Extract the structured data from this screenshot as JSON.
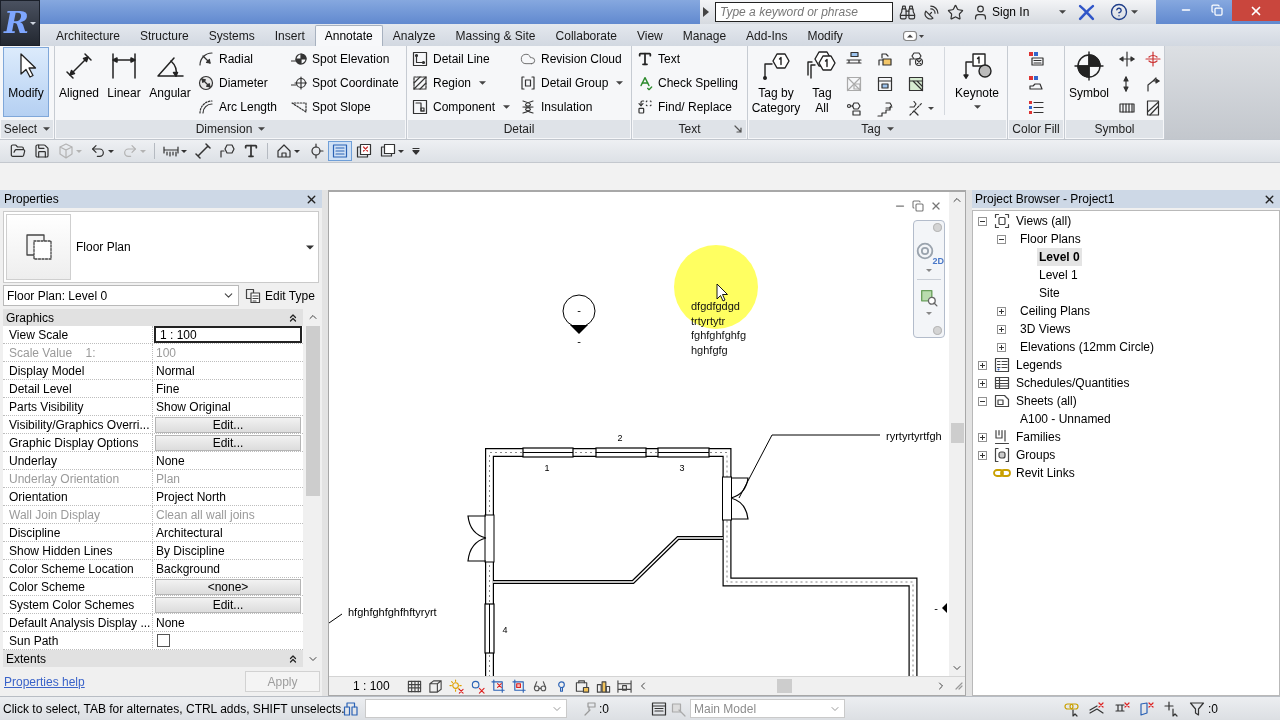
{
  "app_menu": {
    "logo": "R"
  },
  "title_bar": {
    "search": {
      "placeholder": "Type a keyword or phrase"
    },
    "sign_in": "Sign In"
  },
  "tabs": [
    {
      "label": "Architecture",
      "selected": false
    },
    {
      "label": "Structure",
      "selected": false
    },
    {
      "label": "Systems",
      "selected": false
    },
    {
      "label": "Insert",
      "selected": false
    },
    {
      "label": "Annotate",
      "selected": true
    },
    {
      "label": "Analyze",
      "selected": false
    },
    {
      "label": "Massing & Site",
      "selected": false
    },
    {
      "label": "Collaborate",
      "selected": false
    },
    {
      "label": "View",
      "selected": false
    },
    {
      "label": "Manage",
      "selected": false
    },
    {
      "label": "Add-Ins",
      "selected": false
    },
    {
      "label": "Modify",
      "selected": false
    }
  ],
  "ribbon": {
    "panels": [
      {
        "kind": "select",
        "title": "Select",
        "dropdown": true,
        "launcher": false,
        "buttons": [
          {
            "label": "Modify",
            "active": true,
            "dropdown": false
          }
        ]
      },
      {
        "kind": "dimension",
        "title": "Dimension",
        "dropdown": true,
        "launcher": false,
        "buttons": [
          {
            "label": "Aligned",
            "dropdown": false
          },
          {
            "label": "Linear",
            "dropdown": false
          },
          {
            "label": "Angular",
            "dropdown": false
          },
          {
            "label": "Radial",
            "dropdown": false
          },
          {
            "label": "Diameter",
            "dropdown": false
          },
          {
            "label": "Arc Length",
            "dropdown": false
          },
          {
            "label": "Spot Elevation",
            "dropdown": false
          },
          {
            "label": "Spot Coordinate",
            "dropdown": false
          },
          {
            "label": "Spot Slope",
            "dropdown": false
          }
        ]
      },
      {
        "kind": "detail",
        "title": "Detail",
        "dropdown": false,
        "launcher": false,
        "buttons": [
          {
            "label": "Detail Line",
            "dropdown": false
          },
          {
            "label": "Region",
            "dropdown": true
          },
          {
            "label": "Component",
            "dropdown": true
          },
          {
            "label": "Revision Cloud",
            "dropdown": false
          },
          {
            "label": "Detail Group",
            "dropdown": true
          },
          {
            "label": "Insulation",
            "dropdown": false
          }
        ]
      },
      {
        "kind": "text",
        "title": "Text",
        "dropdown": false,
        "launcher": true,
        "buttons": [
          {
            "label": "Text",
            "dropdown": false
          },
          {
            "label": "Check Spelling",
            "dropdown": false
          },
          {
            "label": "Find/ Replace",
            "dropdown": false
          }
        ]
      },
      {
        "kind": "tag",
        "title": "Tag",
        "dropdown": true,
        "launcher": false,
        "buttons": [
          {
            "label": "Tag by\nCategory"
          },
          {
            "label": "Tag\nAll"
          },
          {
            "label": "Keynote",
            "dropdown": true
          }
        ]
      },
      {
        "kind": "color_fill",
        "title": "Color Fill",
        "dropdown": false,
        "launcher": false
      },
      {
        "kind": "symbol",
        "title": "Symbol",
        "dropdown": false,
        "launcher": false,
        "buttons": [
          {
            "label": "Symbol",
            "dropdown": false
          }
        ]
      }
    ]
  },
  "quick_access": [
    {
      "kind": "open",
      "disabled": false,
      "menu": false,
      "active": false
    },
    {
      "kind": "save",
      "disabled": false,
      "menu": false,
      "active": false
    },
    {
      "kind": "sync",
      "disabled": true,
      "menu": true,
      "active": false
    },
    {
      "kind": "undo",
      "disabled": false,
      "menu": true,
      "active": false
    },
    {
      "kind": "redo",
      "disabled": true,
      "menu": true,
      "active": false
    },
    {
      "kind": "measure",
      "disabled": false,
      "menu": true,
      "active": false
    },
    {
      "kind": "aligned_dimension",
      "disabled": false,
      "menu": false,
      "active": false
    },
    {
      "kind": "tag",
      "disabled": false,
      "menu": false,
      "active": false
    },
    {
      "kind": "text",
      "disabled": false,
      "menu": false,
      "active": false
    },
    {
      "kind": "default_3d",
      "disabled": false,
      "menu": true,
      "active": false
    },
    {
      "kind": "section",
      "disabled": false,
      "menu": false,
      "active": false
    },
    {
      "kind": "thin_lines",
      "disabled": false,
      "menu": false,
      "active": true
    },
    {
      "kind": "close_hidden",
      "disabled": false,
      "menu": false,
      "active": false
    },
    {
      "kind": "switch_windows",
      "disabled": false,
      "menu": true,
      "active": false
    },
    {
      "kind": "customize",
      "disabled": false,
      "menu": false,
      "active": false
    }
  ],
  "properties": {
    "title": "Properties",
    "type_name": "Floor Plan",
    "instance": "Floor Plan: Level 0",
    "edit_type": "Edit Type",
    "groups": [
      {
        "title": "Graphics",
        "rows": [
          {
            "label": "View Scale",
            "value": "1 : 100",
            "kind": "field",
            "disabled": false
          },
          {
            "label": "Scale Value    1:",
            "value": "100",
            "kind": "text",
            "disabled": true
          },
          {
            "label": "Display Model",
            "value": "Normal",
            "kind": "text",
            "disabled": false
          },
          {
            "label": "Detail Level",
            "value": "Fine",
            "kind": "text",
            "disabled": false
          },
          {
            "label": "Parts Visibility",
            "value": "Show Original",
            "kind": "text",
            "disabled": false
          },
          {
            "label": "Visibility/Graphics Overri...",
            "value": "Edit...",
            "kind": "button",
            "disabled": false
          },
          {
            "label": "Graphic Display Options",
            "value": "Edit...",
            "kind": "button",
            "disabled": false
          },
          {
            "label": "Underlay",
            "value": "None",
            "kind": "text",
            "disabled": false
          },
          {
            "label": "Underlay Orientation",
            "value": "Plan",
            "kind": "text",
            "disabled": true
          },
          {
            "label": "Orientation",
            "value": "Project North",
            "kind": "text",
            "disabled": false
          },
          {
            "label": "Wall Join Display",
            "value": "Clean all wall joins",
            "kind": "text",
            "disabled": true
          },
          {
            "label": "Discipline",
            "value": "Architectural",
            "kind": "text",
            "disabled": false
          },
          {
            "label": "Show Hidden Lines",
            "value": "By Discipline",
            "kind": "text",
            "disabled": false
          },
          {
            "label": "Color Scheme Location",
            "value": "Background",
            "kind": "text",
            "disabled": false
          },
          {
            "label": "Color Scheme",
            "value": "<none>",
            "kind": "button",
            "disabled": false
          },
          {
            "label": "System Color Schemes",
            "value": "Edit...",
            "kind": "button",
            "disabled": false
          },
          {
            "label": "Default Analysis Display ...",
            "value": "None",
            "kind": "text",
            "disabled": false
          },
          {
            "label": "Sun Path",
            "kind": "checkbox",
            "checked": false,
            "disabled": false
          }
        ]
      },
      {
        "title": "Extents"
      }
    ],
    "help": "Properties help",
    "apply": {
      "label": "Apply",
      "disabled": true
    }
  },
  "canvas": {
    "text_note": [
      "dfgdfgdgd",
      "trtyrtytr",
      "fghfghfghfg",
      "hghfgfg"
    ],
    "leader_notes": [
      "ryrtyrtyrtfgh",
      "hfghfghfghfhftyryrt"
    ],
    "window_tags": [
      "1",
      "2",
      "3",
      "4"
    ],
    "elevation_labels": [
      "-",
      "-",
      "-"
    ],
    "nav_wheel_label": "2D",
    "view_scale": "1 : 100"
  },
  "project_browser": {
    "title": "Project Browser - Project1",
    "tree": [
      {
        "label": "Views (all)",
        "kind": "views",
        "expanded": true,
        "selected": false,
        "children": [
          {
            "label": "Floor Plans",
            "expanded": true,
            "selected": false,
            "children": [
              {
                "label": "Level 0",
                "selected": true
              },
              {
                "label": "Level 1",
                "selected": false
              },
              {
                "label": "Site",
                "selected": false
              }
            ]
          },
          {
            "label": "Ceiling Plans",
            "expanded": false,
            "selected": false
          },
          {
            "label": "3D Views",
            "expanded": false,
            "selected": false
          },
          {
            "label": "Elevations (12mm Circle)",
            "expanded": false,
            "selected": false
          }
        ]
      },
      {
        "label": "Legends",
        "kind": "legends",
        "expanded": false,
        "selected": false
      },
      {
        "label": "Schedules/Quantities",
        "kind": "schedules",
        "expanded": false,
        "selected": false
      },
      {
        "label": "Sheets (all)",
        "kind": "sheets",
        "expanded": true,
        "selected": false,
        "children": [
          {
            "label": "A100 - Unnamed",
            "selected": false
          }
        ]
      },
      {
        "label": "Families",
        "kind": "families",
        "expanded": false,
        "selected": false
      },
      {
        "label": "Groups",
        "kind": "groups",
        "expanded": false,
        "selected": false
      },
      {
        "label": "Revit Links",
        "kind": "links",
        "selected": false
      }
    ]
  },
  "status_bar": {
    "message": "Click to select, TAB for alternates, CTRL adds, SHIFT unselects.",
    "editable_count": ":0",
    "model": {
      "value": "Main Model",
      "disabled": true
    },
    "selection_count": ":0"
  }
}
